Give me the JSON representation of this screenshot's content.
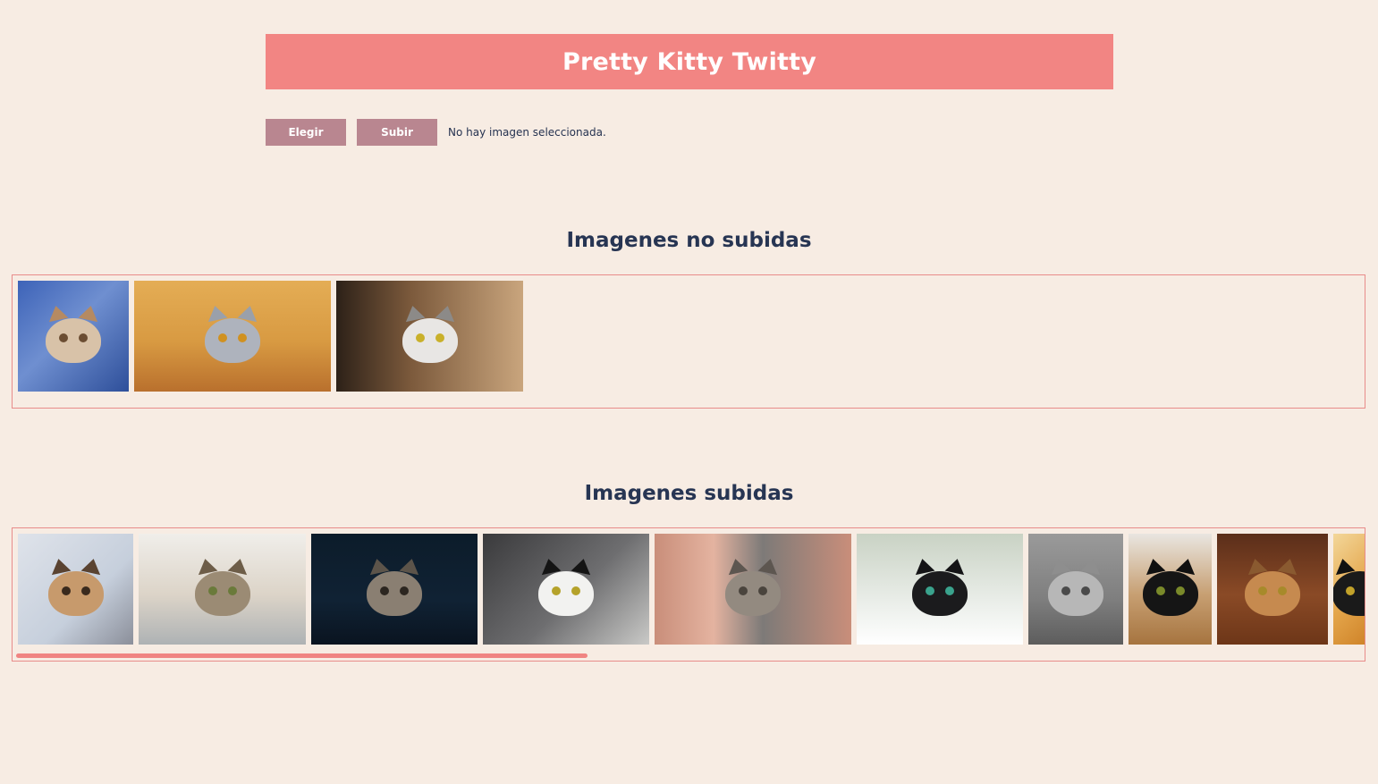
{
  "header": {
    "title": "Pretty Kitty Twitty"
  },
  "controls": {
    "choose_label": "Elegir",
    "upload_label": "Subir",
    "status_text": "No hay imagen seleccionada."
  },
  "pending": {
    "title": "Imagenes no subidas",
    "images": [
      {
        "name": "cat-tongue-photo",
        "width": 124,
        "bg": "linear-gradient(135deg,#3d63b8 0%,#6f8fd0 45%,#2e4f9a 100%)",
        "fur": "#d8c2a8",
        "ear": "#b58a62",
        "eye": "#6b4d32"
      },
      {
        "name": "grey-cat-peeking-photo",
        "width": 220,
        "bg": "linear-gradient(180deg,#e4ad55 0%,#d89a42 55%,#b9702d 100%)",
        "fur": "#aeb3bd",
        "ear": "#9aa0aa",
        "eye": "#d09120"
      },
      {
        "name": "cat-in-paper-roll-photo",
        "width": 209,
        "bg": "linear-gradient(90deg,#2d2118 0%,#7c5a3c 40%,#c9a57d 100%)",
        "fur": "#e8e6e4",
        "ear": "#8c8a88",
        "eye": "#c9b02a"
      }
    ]
  },
  "uploaded": {
    "title": "Imagenes subidas",
    "images": [
      {
        "name": "tabby-yawning-photo",
        "width": 129,
        "bg": "linear-gradient(135deg,#dfe3ea 0%,#c6cfdc 60%,#8b8f9a 100%)",
        "fur": "#c79a6c",
        "ear": "#5a4331",
        "eye": "#3a2a1d"
      },
      {
        "name": "tabby-lying-sofa-photo",
        "width": 187,
        "bg": "linear-gradient(180deg,#f0eeea 0%,#dcd4c8 55%,#aeb2b4 100%)",
        "fur": "#9b8b74",
        "ear": "#6d5d48",
        "eye": "#6a7a3a"
      },
      {
        "name": "tabby-dark-background-photo",
        "width": 186,
        "bg": "linear-gradient(180deg,#0c1c2a 0%,#102234 60%,#0a1420 100%)",
        "fur": "#8a7f72",
        "ear": "#5c544a",
        "eye": "#2c2620"
      },
      {
        "name": "tuxedo-cat-sofa-photo",
        "width": 186,
        "bg": "linear-gradient(135deg,#3a3a3c 0%,#6e6e70 55%,#c9c9c7 100%)",
        "fur": "#f2f2f0",
        "ear": "#141414",
        "eye": "#b5a22a"
      },
      {
        "name": "cat-face-hands-photo",
        "width": 220,
        "bg": "linear-gradient(90deg,#c98e7a 0%,#e4b3a0 30%,#7d7a78 55%,#c98e7a 100%)",
        "fur": "#938a80",
        "ear": "#5d5650",
        "eye": "#4a443d"
      },
      {
        "name": "black-cat-green-eyes-photo",
        "width": 186,
        "bg": "linear-gradient(180deg,#c9d2c4 0%,#e9ede8 60%,#ffffff 100%)",
        "fur": "#1b1b1d",
        "ear": "#141416",
        "eye": "#3aa38d"
      },
      {
        "name": "grey-cat-sitting-photo",
        "width": 106,
        "bg": "linear-gradient(180deg,#9a9a9a 0%,#7e7e7e 60%,#5d5d5d 100%)",
        "fur": "#b7b7b7",
        "ear": "#8e8e8e",
        "eye": "#4a4a4a"
      },
      {
        "name": "black-cat-wood-floor-photo",
        "width": 93,
        "bg": "linear-gradient(180deg,#e9e6e1 0%,#c79f72 55%,#a6743f 100%)",
        "fur": "#151515",
        "ear": "#101010",
        "eye": "#7a8a2a"
      },
      {
        "name": "tabby-cat-box-photo",
        "width": 124,
        "bg": "linear-gradient(180deg,#5b2e1a 0%,#8a4a26 55%,#6d3618 100%)",
        "fur": "#c68a4f",
        "ear": "#8a5a30",
        "eye": "#a78a2a"
      },
      {
        "name": "cat-autumn-leaves-photo",
        "width": 60,
        "bg": "linear-gradient(135deg,#f3d79a 0%,#e4a54a 50%,#c8781e 100%)",
        "fur": "#1a1a1a",
        "ear": "#111111",
        "eye": "#c2a22a"
      }
    ],
    "scroll_position": 0
  }
}
